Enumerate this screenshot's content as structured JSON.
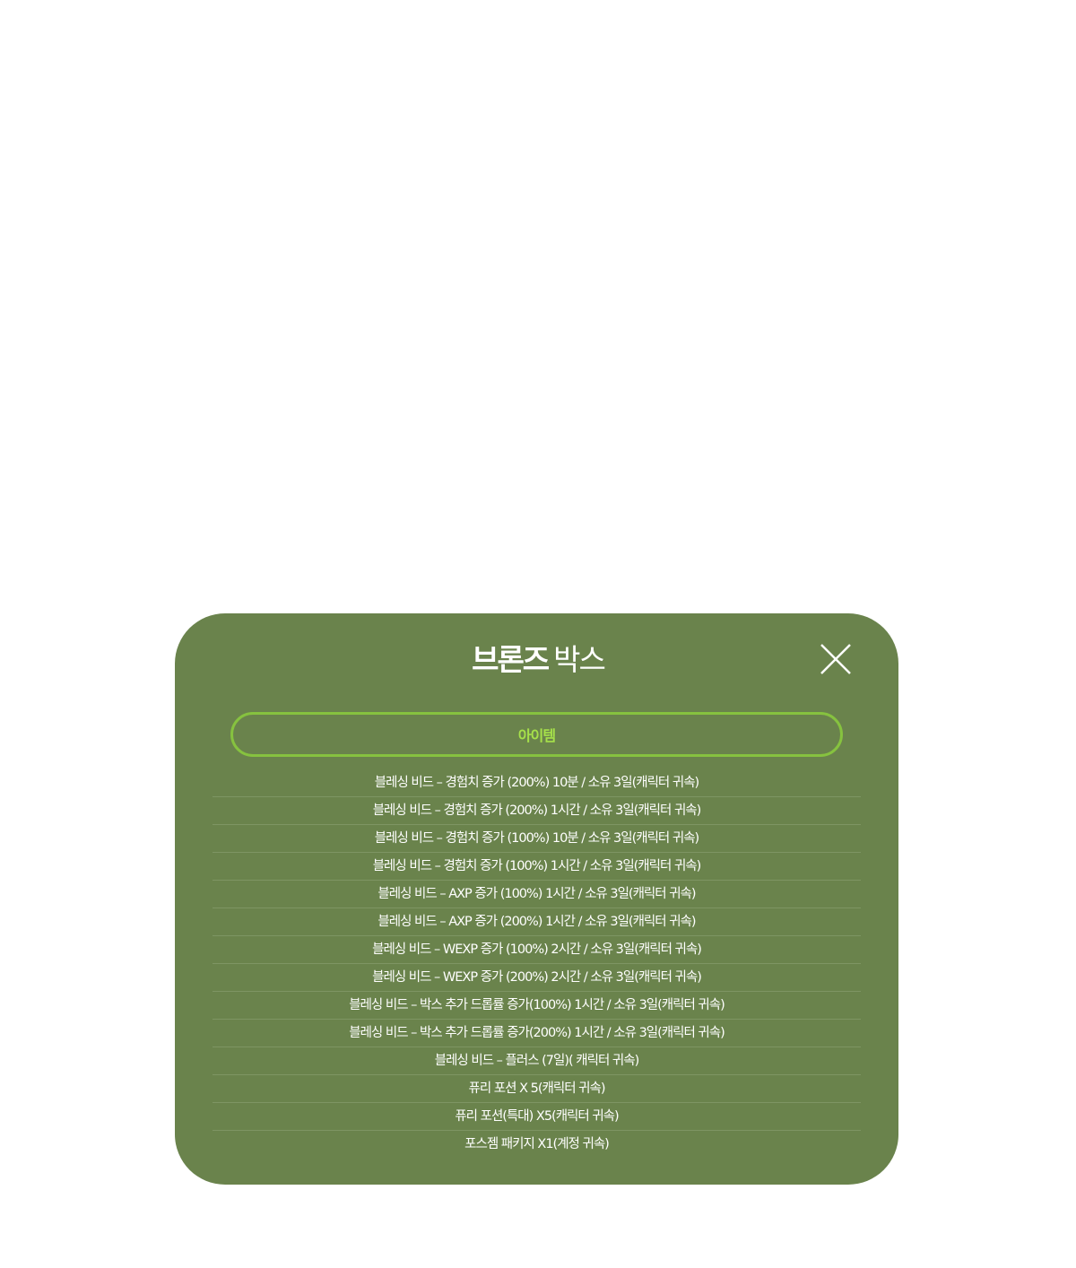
{
  "modal": {
    "title_strong": "브론즈",
    "title_light": "박스",
    "close_icon": "close-x-icon",
    "tab_label": "아이템",
    "colors": {
      "background": "#6a834c",
      "tab_border": "#86c23f",
      "tab_text": "#a6e04a",
      "text": "#ffffff"
    },
    "items": [
      "블레싱 비드 – 경험치 증가 (200%) 10분 / 소유 3일(캐릭터 귀속)",
      "블레싱 비드 – 경험치 증가 (200%) 1시간 / 소유 3일(캐릭터 귀속)",
      "블레싱 비드 – 경험치 증가 (100%) 10분 / 소유 3일(캐릭터 귀속)",
      "블레싱 비드 – 경험치 증가 (100%) 1시간 / 소유 3일(캐릭터 귀속)",
      "블레싱 비드 – AXP 증가 (100%) 1시간 / 소유 3일(캐릭터 귀속)",
      "블레싱 비드 – AXP 증가 (200%) 1시간 / 소유 3일(캐릭터 귀속)",
      "블레싱 비드 – WEXP 증가 (100%) 2시간 / 소유 3일(캐릭터 귀속)",
      "블레싱 비드 – WEXP 증가 (200%) 2시간 / 소유 3일(캐릭터 귀속)",
      "블레싱 비드 – 박스 추가 드롭률 증가(100%) 1시간 / 소유 3일(캐릭터 귀속)",
      "블레싱 비드 – 박스 추가 드롭률 증가(200%) 1시간 / 소유 3일(캐릭터 귀속)",
      "블레싱 비드 – 플러스 (7일)( 캐릭터 귀속)",
      "퓨리 포션 X 5(캐릭터 귀속)",
      "퓨리 포션(특대) X5(캐릭터 귀속)",
      "포스젬 패키지 X1(계정 귀속)"
    ]
  }
}
